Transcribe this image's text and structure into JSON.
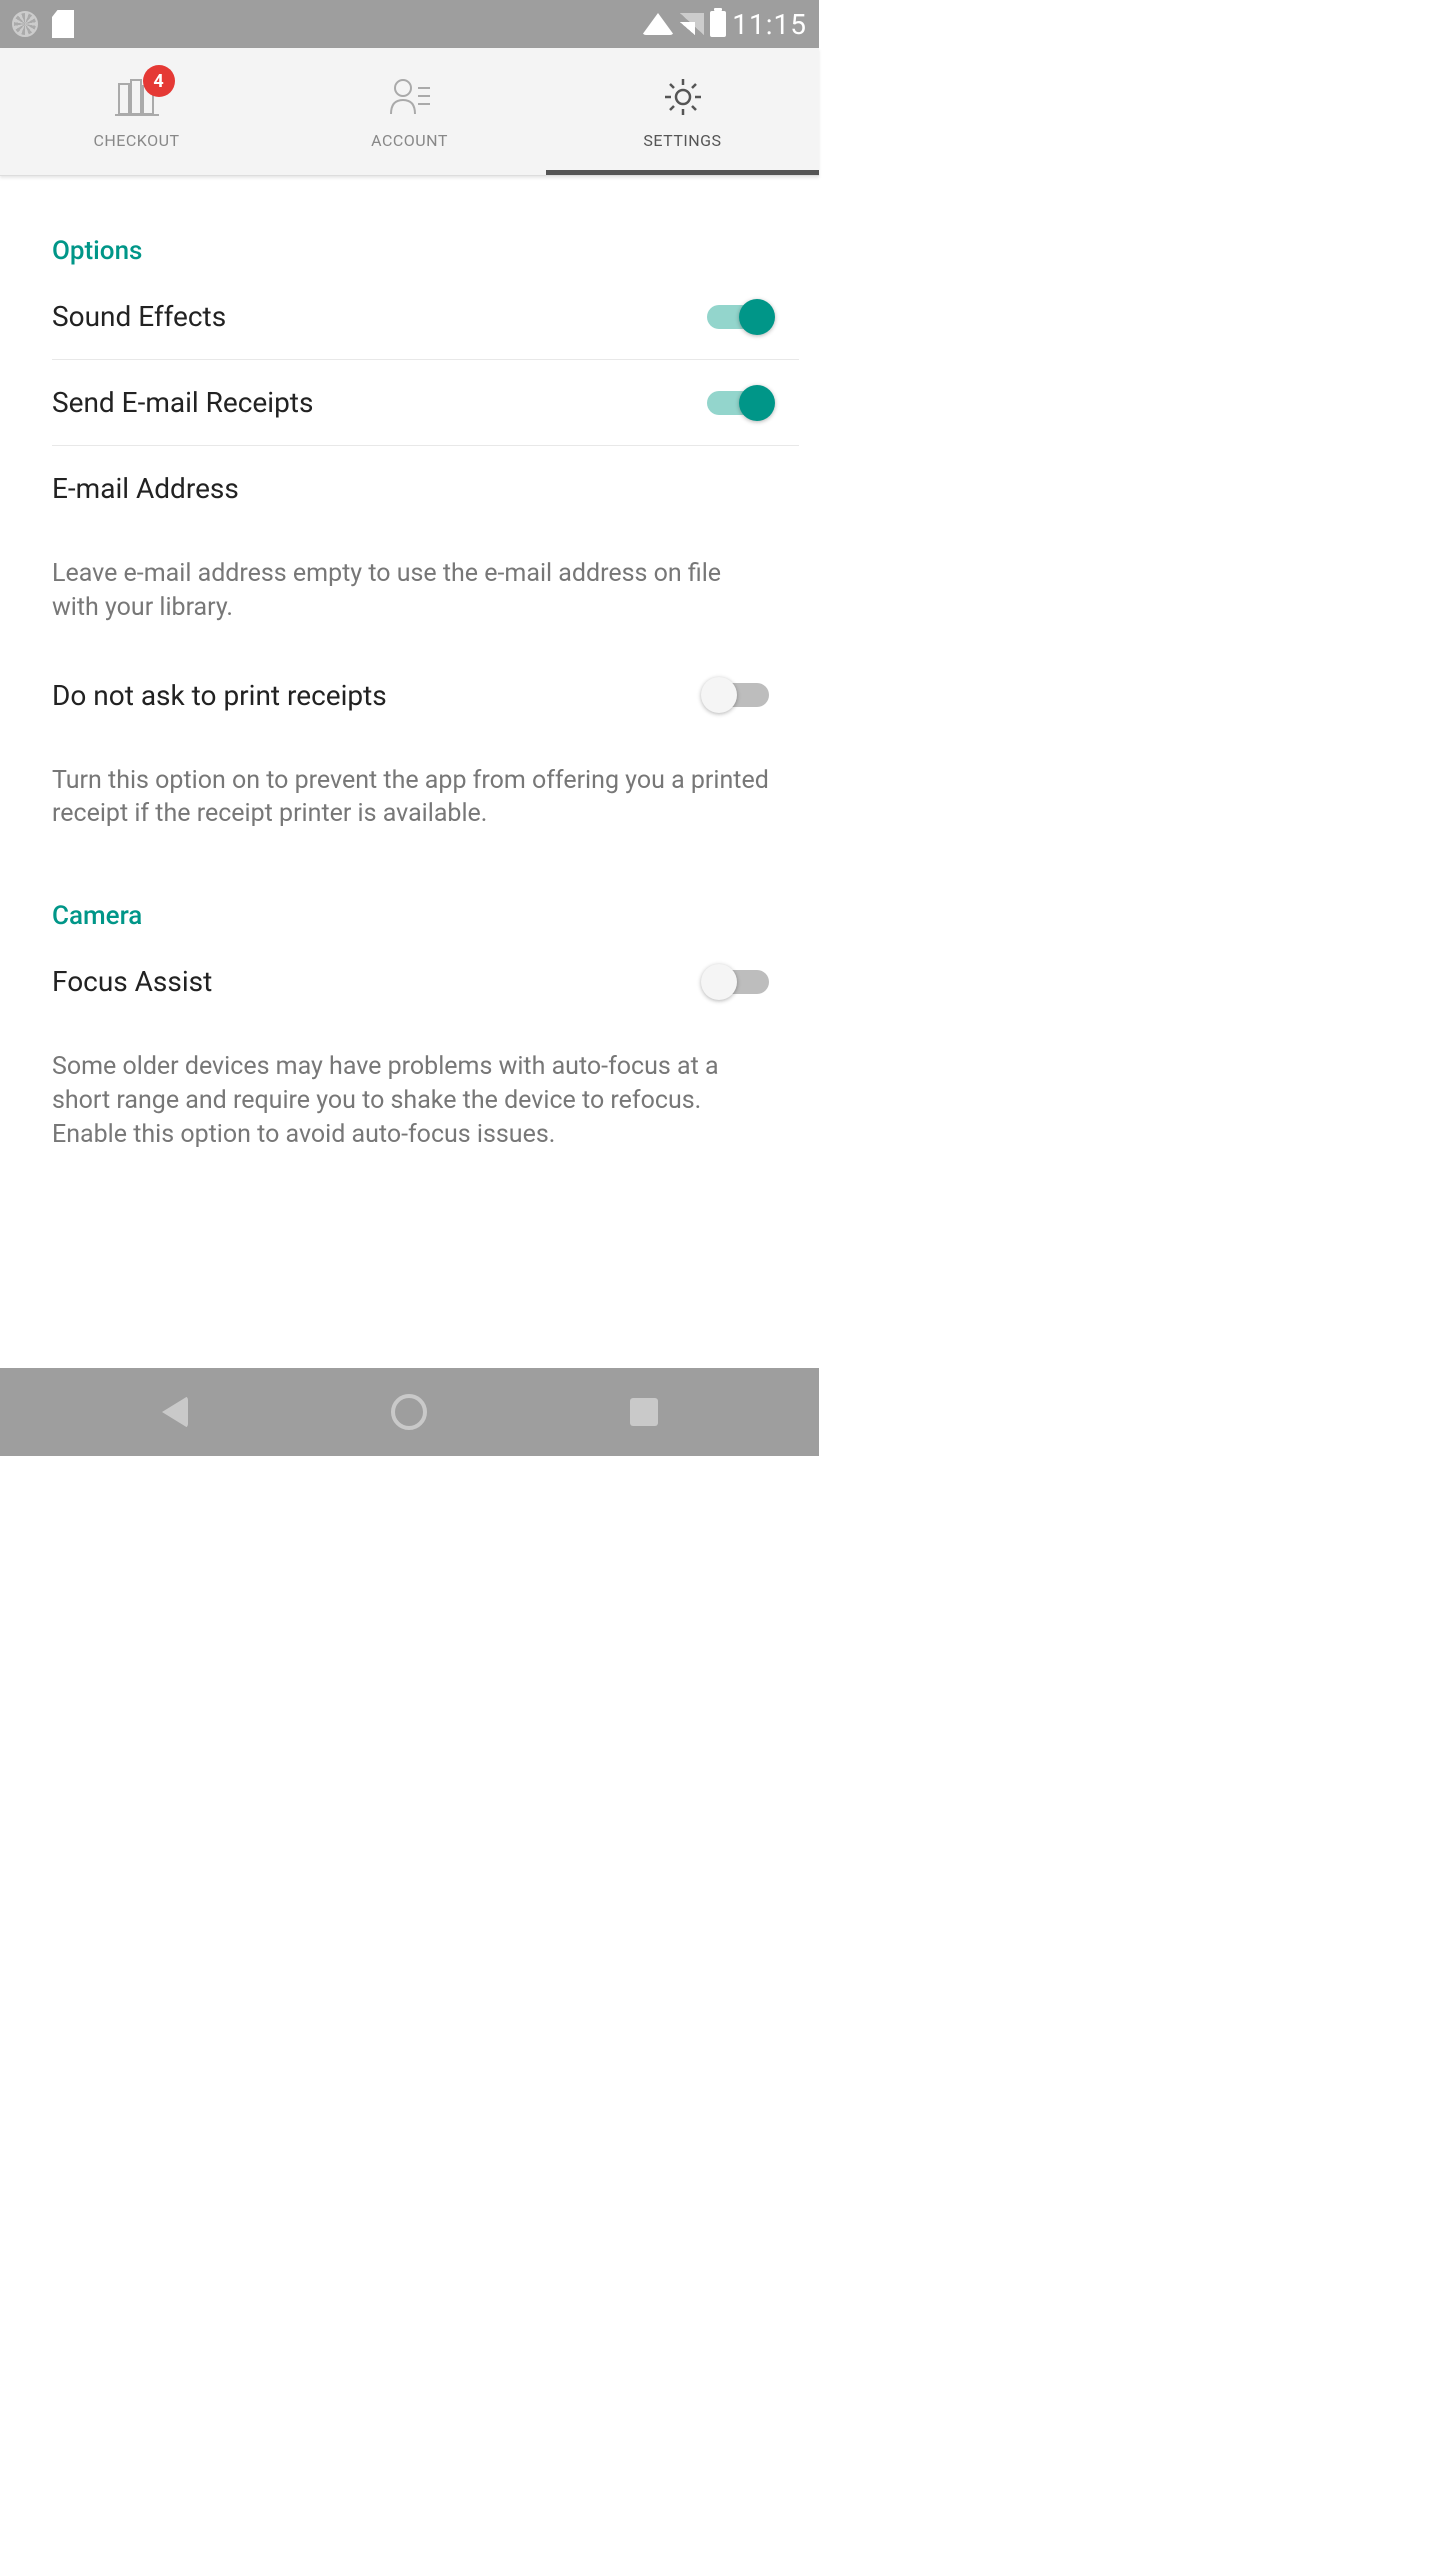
{
  "status": {
    "time": "11:15"
  },
  "tabs": {
    "checkout": {
      "label": "CHECKOUT",
      "badge": "4"
    },
    "account": {
      "label": "ACCOUNT"
    },
    "settings": {
      "label": "SETTINGS"
    }
  },
  "sections": {
    "options": {
      "title": "Options",
      "sound_effects": {
        "label": "Sound Effects"
      },
      "send_receipts": {
        "label": "Send E-mail Receipts"
      },
      "email_address": {
        "label": "E-mail Address"
      },
      "email_desc": "Leave e-mail address empty to use the e-mail address on file with your library.",
      "no_print": {
        "label": "Do not ask to print receipts"
      },
      "no_print_desc": "Turn this option on to prevent the app from offering you a printed receipt if the receipt printer is available."
    },
    "camera": {
      "title": "Camera",
      "focus_assist": {
        "label": "Focus Assist"
      },
      "focus_desc": "Some older devices may have problems with auto-focus at a short range and require you to shake the device to refocus. Enable this option to avoid auto-focus issues."
    }
  }
}
